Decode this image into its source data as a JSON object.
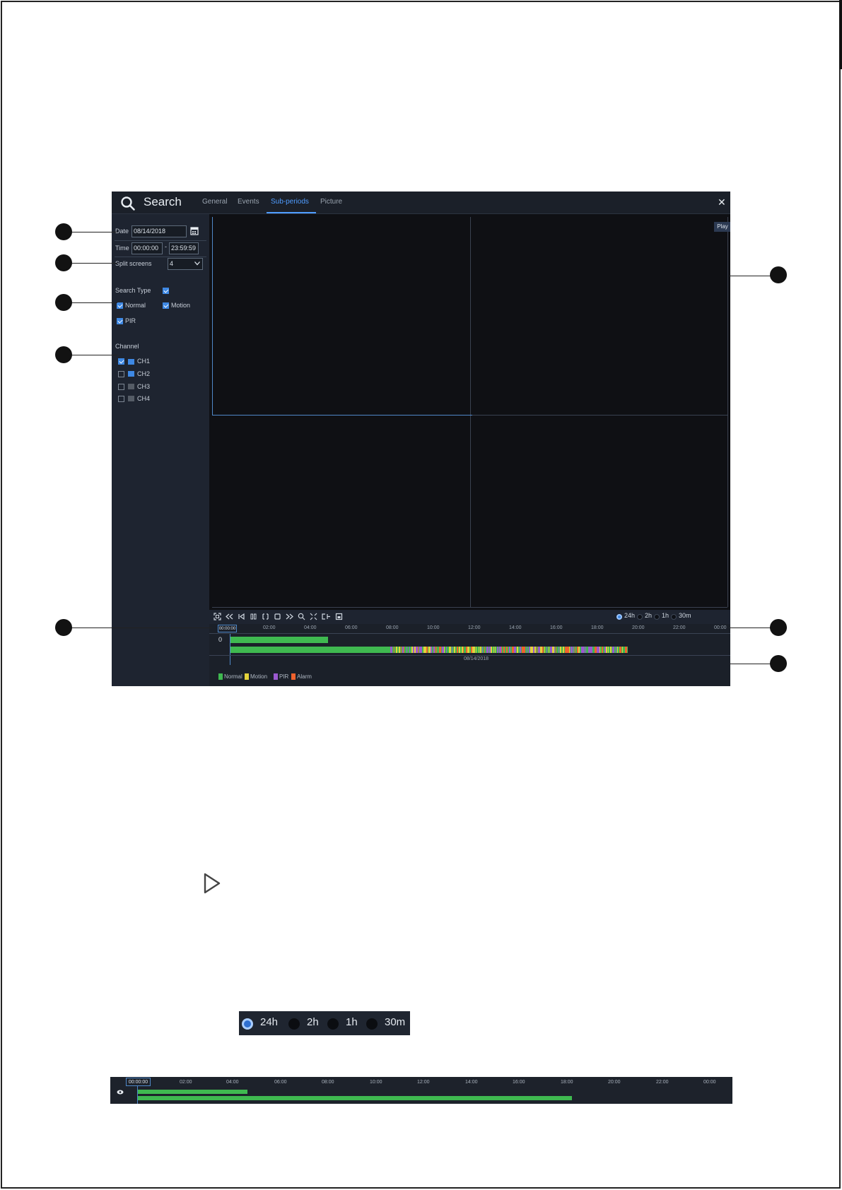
{
  "app": {
    "title": "Search",
    "close_glyph": "✕"
  },
  "tabs": [
    {
      "label": "General",
      "active": false
    },
    {
      "label": "Events",
      "active": false
    },
    {
      "label": "Sub-periods",
      "active": true
    },
    {
      "label": "Picture",
      "active": false
    }
  ],
  "sidebar": {
    "date_label": "Date",
    "date_value": "08/14/2018",
    "time_label": "Time",
    "time_start": "00:00:00",
    "time_sep": "-",
    "time_end": "23:59:59",
    "split_label": "Split screens",
    "split_value": "4",
    "search_type_label": "Search Type",
    "types": [
      {
        "label": "Normal",
        "checked": true
      },
      {
        "label": "Motion",
        "checked": true
      },
      {
        "label": "PIR",
        "checked": true
      }
    ],
    "channel_label": "Channel",
    "channels": [
      {
        "label": "CH1",
        "checked": true,
        "color": "#3e88e3"
      },
      {
        "label": "CH2",
        "checked": false,
        "color": "#3e88e3"
      },
      {
        "label": "CH3",
        "checked": false,
        "color": "#555c66"
      },
      {
        "label": "CH4",
        "checked": false,
        "color": "#555c66"
      }
    ]
  },
  "video": {
    "play_tag": "Play"
  },
  "range_options": [
    {
      "label": "24h",
      "selected": true
    },
    {
      "label": "2h",
      "selected": false
    },
    {
      "label": "1h",
      "selected": false
    },
    {
      "label": "30m",
      "selected": false
    }
  ],
  "timeline": {
    "cursor_time": "00:00:00",
    "row_label": "0",
    "ticks": [
      "02:00",
      "04:00",
      "06:00",
      "08:00",
      "10:00",
      "12:00",
      "14:00",
      "16:00",
      "18:00",
      "20:00",
      "22:00",
      "00:00"
    ],
    "date_caption": "08/14/2018",
    "legend": [
      {
        "label": "Normal",
        "color": "#3fb950"
      },
      {
        "label": "Motion",
        "color": "#e3d23a"
      },
      {
        "label": "PIR",
        "color": "#9b59d0"
      },
      {
        "label": "Alarm",
        "color": "#f0622d"
      }
    ]
  },
  "range_image": {
    "options": [
      {
        "label": "24h",
        "selected": true
      },
      {
        "label": "2h",
        "selected": false
      },
      {
        "label": "1h",
        "selected": false
      },
      {
        "label": "30m",
        "selected": false
      }
    ]
  },
  "timeline_image": {
    "cursor_time": "00:00:00",
    "ticks": [
      "02:00",
      "04:00",
      "06:00",
      "08:00",
      "10:00",
      "12:00",
      "14:00",
      "16:00",
      "18:00",
      "20:00",
      "22:00",
      "00:00"
    ]
  },
  "icons": {
    "search": "search-icon",
    "calendar": "calendar-icon",
    "dropdown": "chevron-down-icon",
    "play": "play-icon"
  }
}
